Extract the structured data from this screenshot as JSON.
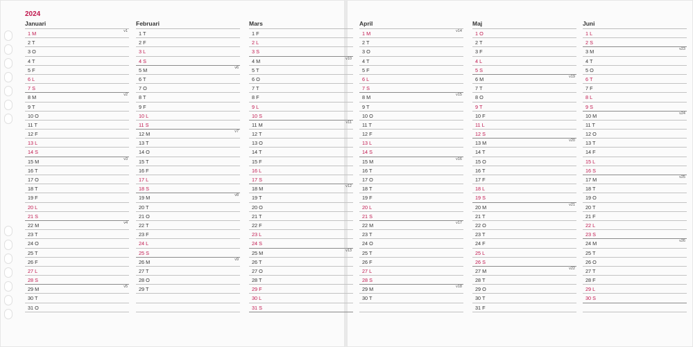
{
  "year": "2024",
  "colors": {
    "accent": "#c0164d",
    "text": "#333333",
    "line": "#c2c2c2",
    "weekline": "#8a8a8a"
  },
  "months": [
    {
      "name": "Januari",
      "start": "M",
      "days": 31,
      "weeks": {
        "1": "v1",
        "8": "v2",
        "15": "v3",
        "22": "v4",
        "29": "v5"
      }
    },
    {
      "name": "Februari",
      "start": "T",
      "days": 29,
      "weeks": {
        "5": "v6",
        "12": "v7",
        "19": "v8",
        "26": "v9"
      }
    },
    {
      "name": "Mars",
      "start": "F",
      "days": 31,
      "weeks": {
        "4": "v10",
        "11": "v11",
        "18": "v12",
        "25": "v13"
      }
    },
    {
      "name": "April",
      "start": "M",
      "days": 30,
      "weeks": {
        "1": "v14",
        "8": "v15",
        "15": "v16",
        "22": "v17",
        "29": "v18"
      }
    },
    {
      "name": "Maj",
      "start": "O",
      "days": 31,
      "weeks": {
        "6": "v19",
        "13": "v20",
        "20": "v21",
        "27": "v22"
      }
    },
    {
      "name": "Juni",
      "start": "L",
      "days": 30,
      "weeks": {
        "3": "v23",
        "10": "v24",
        "17": "v25",
        "24": "v26"
      }
    }
  ],
  "weekday_letters": [
    "M",
    "T",
    "O",
    "T",
    "F",
    "L",
    "S"
  ],
  "weekend_days": [
    "1 M",
    "6 L",
    "7 S",
    "13 L",
    "14 S",
    "20 L",
    "21 S",
    "27 L",
    "28 S"
  ]
}
